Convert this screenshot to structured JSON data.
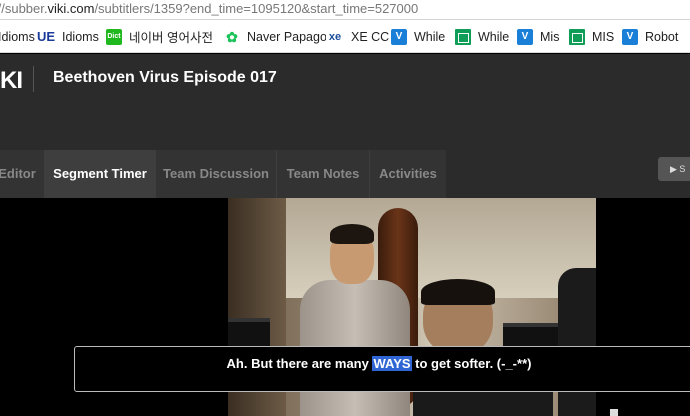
{
  "browser": {
    "url_prefix": "://subber.",
    "url_host": "viki.com",
    "url_path": "/subtitlers/1359?end_time=1095120&start_time=527000"
  },
  "bookmarks": [
    {
      "label": "Idioms",
      "icon": "bookmark-icon"
    },
    {
      "label": "Idioms",
      "icon": "ue-icon",
      "glyph": "UE"
    },
    {
      "label": "네이버 영어사전",
      "icon": "naver-dict-icon",
      "glyph": "Dict"
    },
    {
      "label": "Naver Papago",
      "icon": "papago-icon",
      "glyph": "✿"
    },
    {
      "label": "XE CC",
      "icon": "xe-icon",
      "glyph": "xe"
    },
    {
      "label": "While",
      "icon": "viki-icon",
      "glyph": "V"
    },
    {
      "label": "While",
      "icon": "sheets-icon"
    },
    {
      "label": "Mis",
      "icon": "viki-icon",
      "glyph": "V"
    },
    {
      "label": "MIS",
      "icon": "sheets-icon"
    },
    {
      "label": "Robot",
      "icon": "viki-icon",
      "glyph": "V"
    }
  ],
  "header": {
    "logo": "KI",
    "title": "Beethoven Virus Episode 017"
  },
  "tabs": [
    {
      "label": "Editor"
    },
    {
      "label": "Segment Timer",
      "active": true
    },
    {
      "label": "Team Discussion"
    },
    {
      "label": "Team Notes"
    },
    {
      "label": "Activities"
    }
  ],
  "side_button": {
    "label": "▶ S"
  },
  "subtitle": {
    "before": "Ah. But there are many ",
    "selected": "WAYS",
    "after": " to get softer. (-_-**)"
  },
  "colors": {
    "header_bg": "#2b2b2b",
    "selection": "#2f66d4"
  }
}
